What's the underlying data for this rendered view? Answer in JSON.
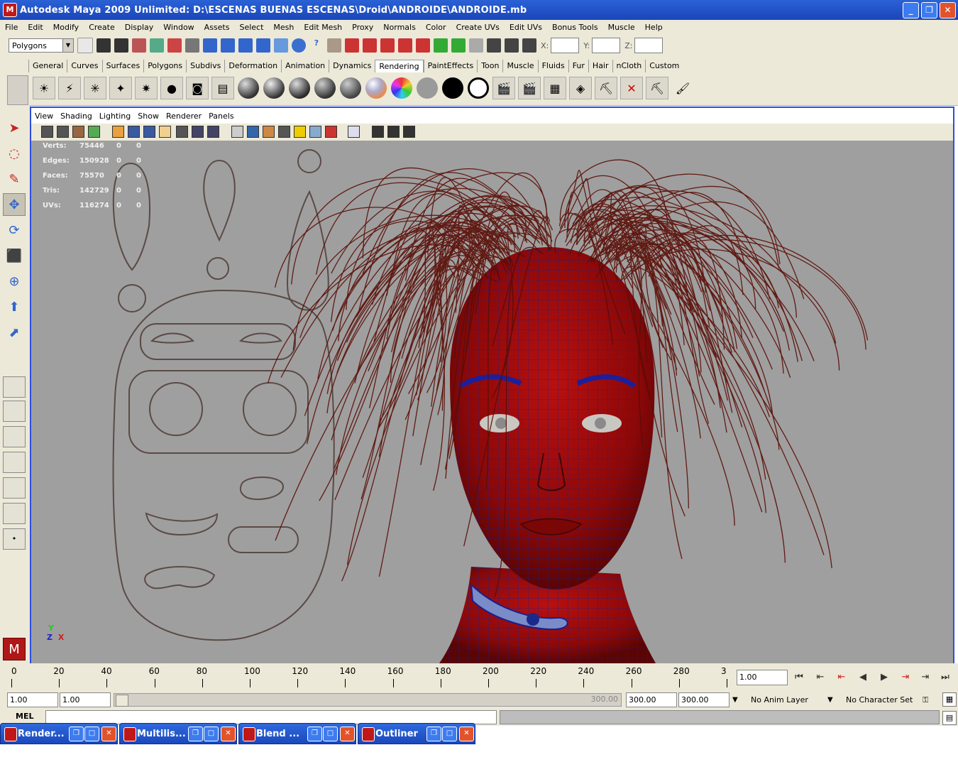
{
  "window": {
    "title": "Autodesk Maya 2009 Unlimited: D:\\ESCENAS BUENAS ESCENAS\\Droid\\ANDROIDE\\ANDROIDE.mb",
    "minimize_glyph": "_",
    "restore_glyph": "❐",
    "close_glyph": "✕"
  },
  "menubar": [
    "File",
    "Edit",
    "Modify",
    "Create",
    "Display",
    "Window",
    "Assets",
    "Select",
    "Mesh",
    "Edit Mesh",
    "Proxy",
    "Normals",
    "Color",
    "Create UVs",
    "Edit UVs",
    "Bonus Tools",
    "Muscle",
    "Help"
  ],
  "statusline": {
    "mode": "Polygons",
    "x_label": "X:",
    "y_label": "Y:",
    "z_label": "Z:"
  },
  "shelf_tabs": [
    "General",
    "Curves",
    "Surfaces",
    "Polygons",
    "Subdivs",
    "Deformation",
    "Animation",
    "Dynamics",
    "Rendering",
    "PaintEffects",
    "Toon",
    "Muscle",
    "Fluids",
    "Fur",
    "Hair",
    "nCloth",
    "Custom"
  ],
  "active_shelf_tab": "Rendering",
  "panel_menu": [
    "View",
    "Shading",
    "Lighting",
    "Show",
    "Renderer",
    "Panels"
  ],
  "hud": {
    "rows": [
      {
        "label": "Verts:",
        "value": "75446",
        "a": "0",
        "b": "0"
      },
      {
        "label": "Edges:",
        "value": "150928",
        "a": "0",
        "b": "0"
      },
      {
        "label": "Faces:",
        "value": "75570",
        "a": "0",
        "b": "0"
      },
      {
        "label": "Tris:",
        "value": "142729",
        "a": "0",
        "b": "0"
      },
      {
        "label": "UVs:",
        "value": "116274",
        "a": "0",
        "b": "0"
      }
    ]
  },
  "axis": {
    "y": "Y",
    "z": "Z",
    "x": "X"
  },
  "timeline": {
    "ticks": [
      "0",
      "20",
      "40",
      "60",
      "80",
      "100",
      "120",
      "140",
      "160",
      "180",
      "200",
      "220",
      "240",
      "260",
      "280",
      "3"
    ],
    "current_frame": "1.00"
  },
  "range": {
    "start": "1.00",
    "playback_start": "1.00",
    "slider_end": "300.00",
    "playback_end": "300.00",
    "end": "300.00",
    "anim_layer": "No Anim Layer",
    "character_set": "No Character Set"
  },
  "cmdline": {
    "label": "MEL"
  },
  "taskbar": [
    "Render...",
    "Multilis...",
    "Blend ...",
    "Outliner"
  ],
  "colors": {
    "viewport_bg": "#9f9f9f",
    "panel_border": "#2c4de0",
    "head_red": "#a00a0a",
    "wire_blue": "#1a1f8a",
    "hair": "#5a0d05",
    "mask_line": "#5b4a46"
  }
}
